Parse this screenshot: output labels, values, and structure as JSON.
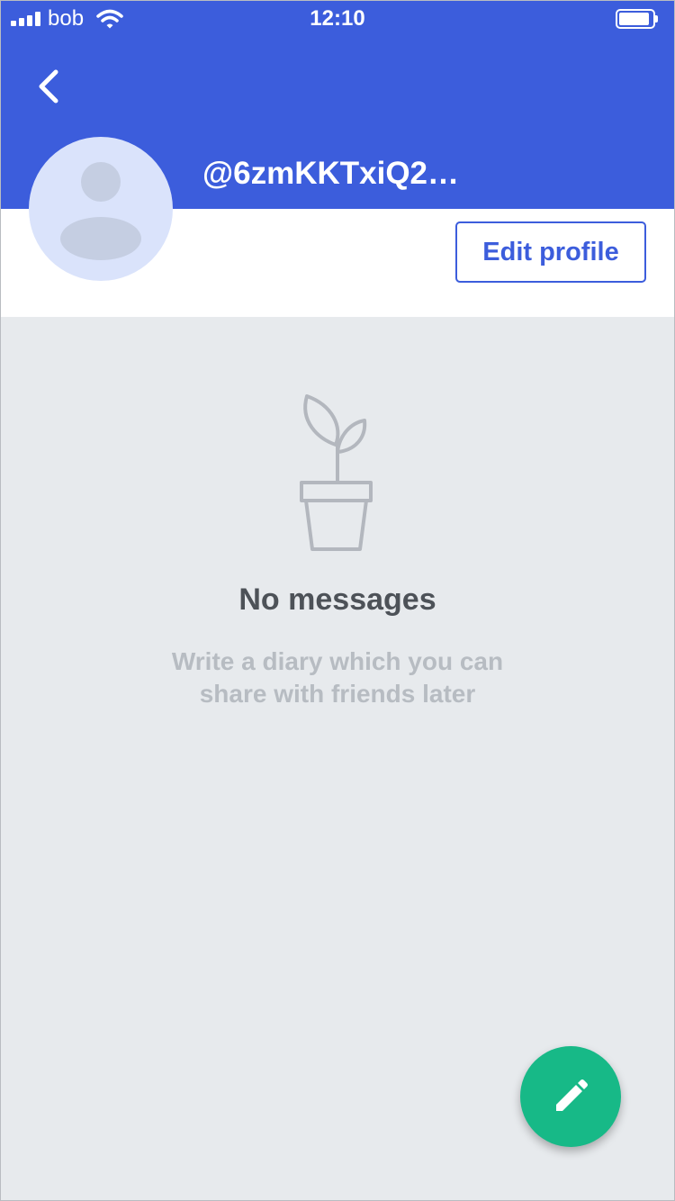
{
  "status_bar": {
    "carrier": "bob",
    "time": "12:10",
    "signal_icon": "cellular-signal-icon",
    "wifi_icon": "wifi-icon",
    "battery_icon": "battery-icon"
  },
  "header": {
    "back_icon": "chevron-left-icon",
    "username": "@6zmKKTxiQ2…",
    "background_color": "#3c5ddc"
  },
  "profile": {
    "avatar_icon": "user-placeholder-icon",
    "edit_profile_label": "Edit profile"
  },
  "empty_state": {
    "icon": "potted-plant-icon",
    "title": "No messages",
    "description": "Write a diary which you can share with friends later"
  },
  "fab": {
    "icon": "pencil-icon",
    "color": "#17b987"
  }
}
